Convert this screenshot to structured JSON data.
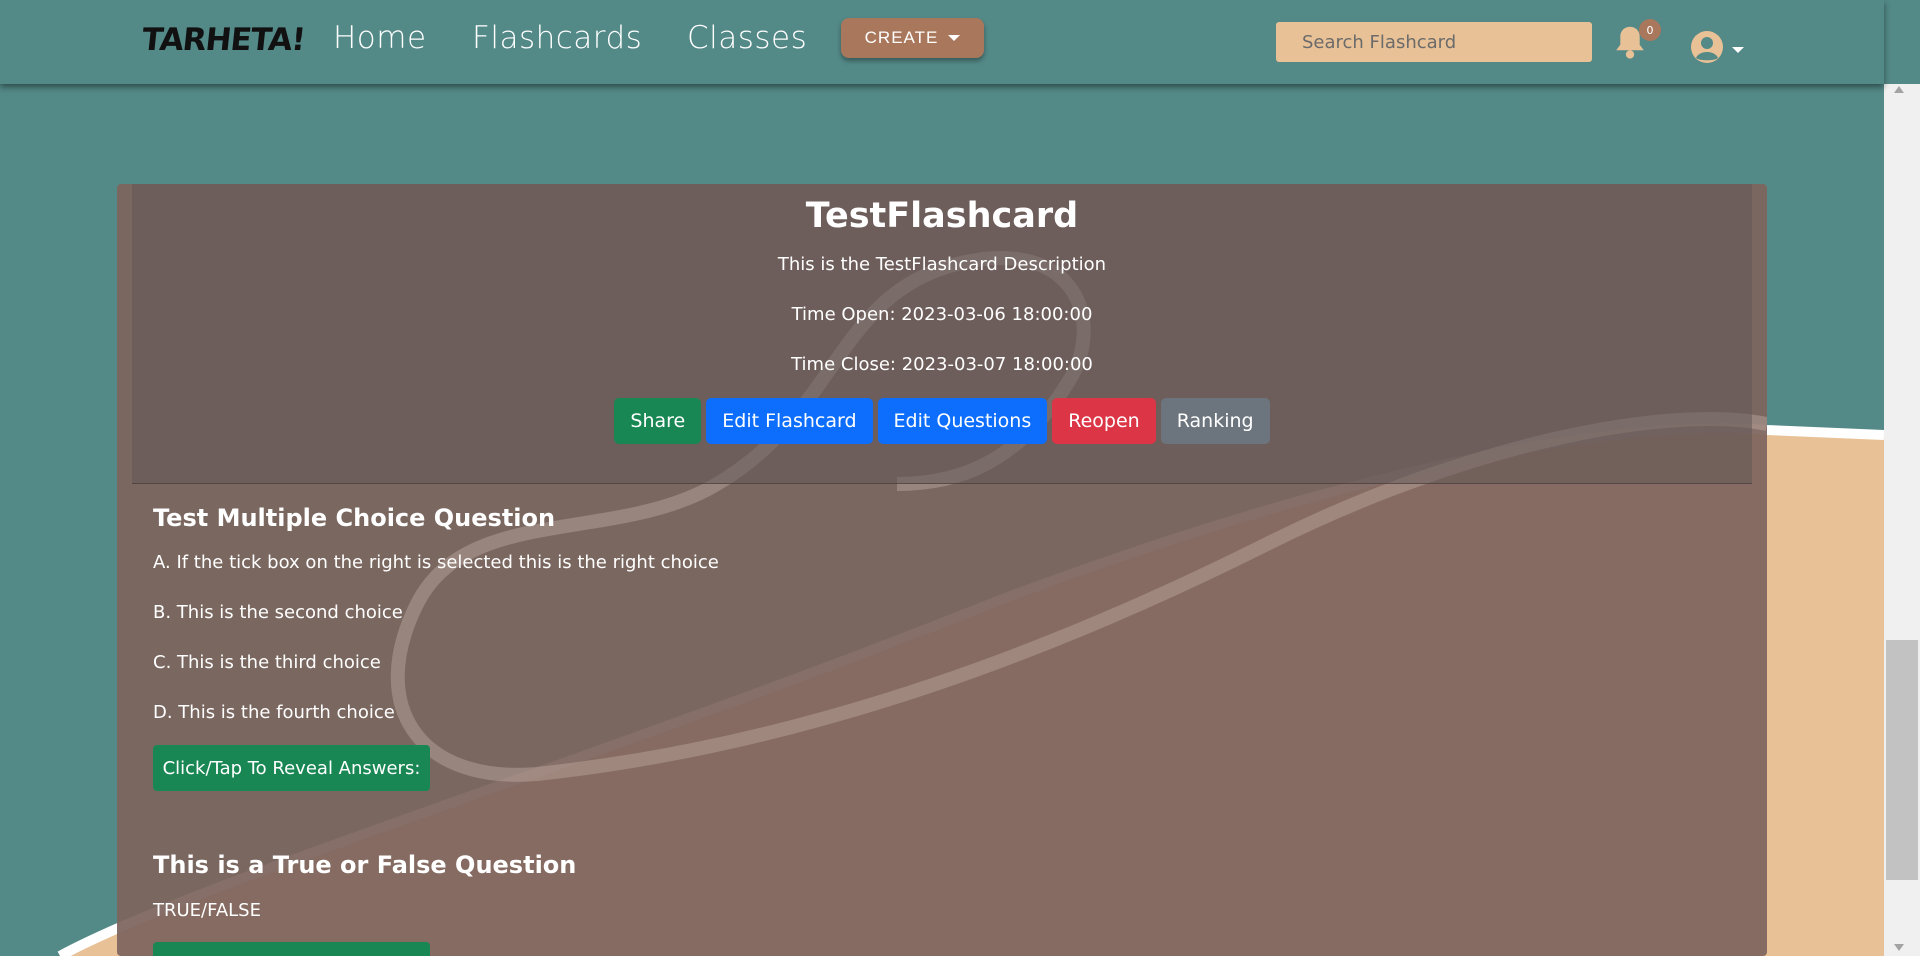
{
  "nav": {
    "logo": "TARHETA!",
    "links": [
      "Home",
      "Flashcards",
      "Classes"
    ],
    "create_label": "CREATE",
    "search_placeholder": "Search Flashcard",
    "notification_count": "0"
  },
  "flashcard": {
    "title": "TestFlashcard",
    "description": "This is the TestFlashcard Description",
    "time_open": "Time Open: 2023-03-06 18:00:00",
    "time_close": "Time Close: 2023-03-07 18:00:00",
    "buttons": {
      "share": "Share",
      "edit_flashcard": "Edit Flashcard",
      "edit_questions": "Edit Questions",
      "reopen": "Reopen",
      "ranking": "Ranking"
    }
  },
  "questions": [
    {
      "title": "Test Multiple Choice Question",
      "choices": [
        "A. If the tick box on the right is selected this is the right choice",
        "B. This is the second choice",
        "C. This is the third choice",
        "D. This is the fourth choice"
      ],
      "reveal_label": "Click/Tap To Reveal Answers:"
    },
    {
      "title": "This is a True or False Question",
      "choices": [
        "TRUE/FALSE"
      ],
      "reveal_label": ""
    }
  ],
  "colors": {
    "teal": "#538987",
    "tan": "#e8c196",
    "brown": "#a9785c",
    "card": "#7d645c"
  }
}
